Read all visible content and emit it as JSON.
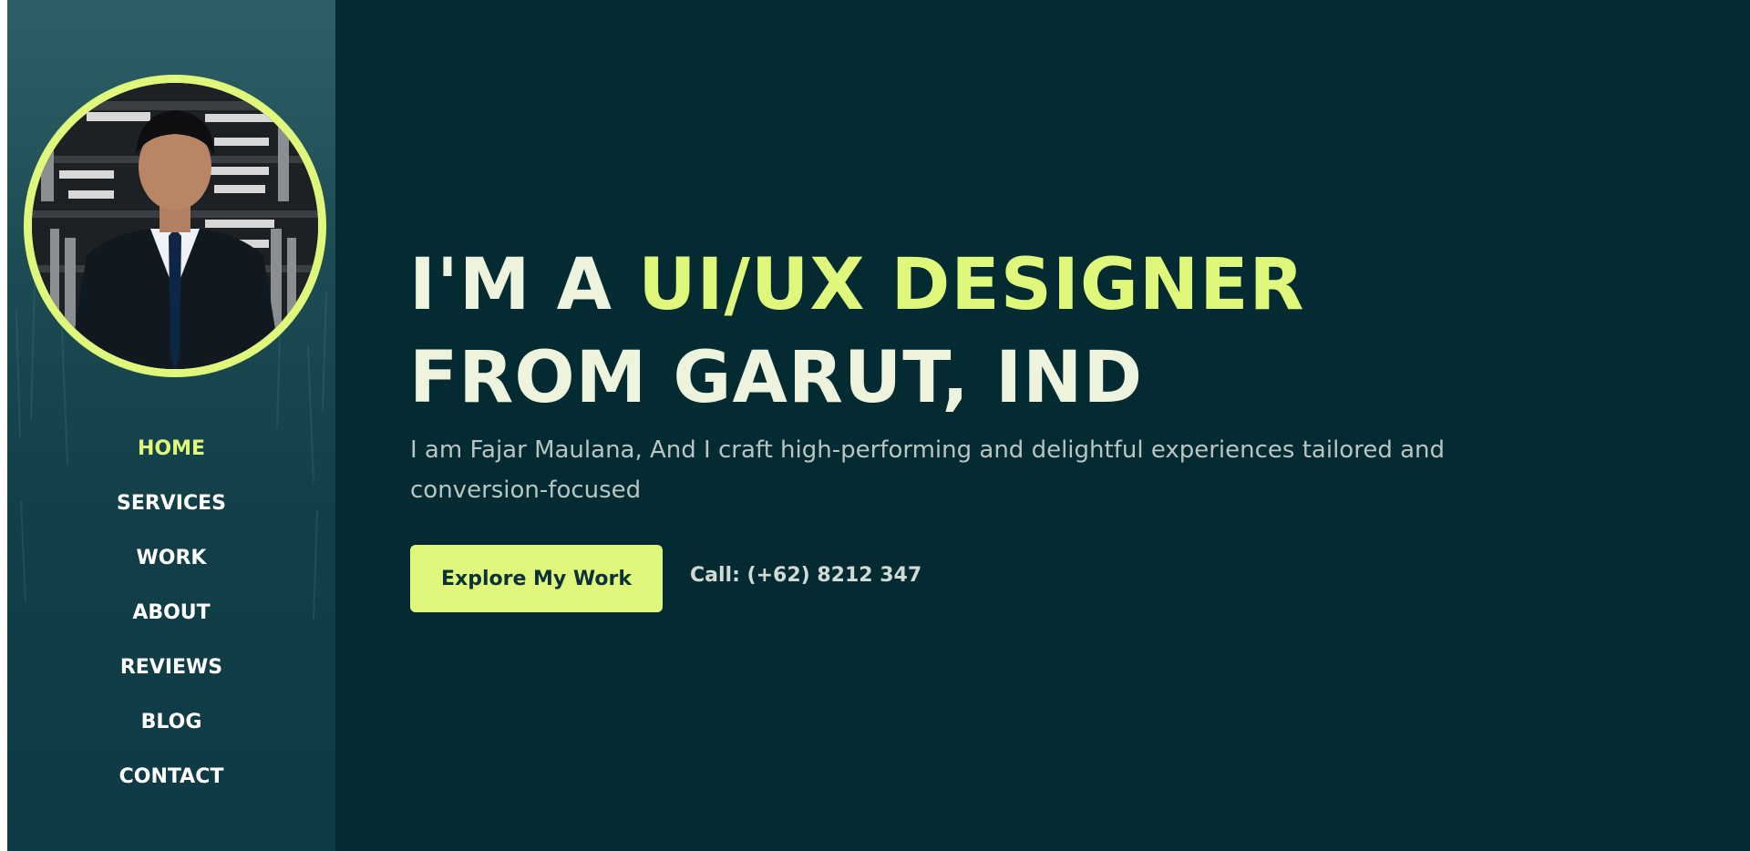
{
  "sidebar": {
    "avatar_alt": "Portrait photo",
    "nav": [
      {
        "label": "HOME",
        "active": true
      },
      {
        "label": "SERVICES",
        "active": false
      },
      {
        "label": "WORK",
        "active": false
      },
      {
        "label": "ABOUT",
        "active": false
      },
      {
        "label": "REVIEWS",
        "active": false
      },
      {
        "label": "BLOG",
        "active": false
      },
      {
        "label": "CONTACT",
        "active": false
      }
    ]
  },
  "hero": {
    "title_prefix": "I'M A ",
    "title_accent": "UI/UX DESIGNER",
    "title_line2": "FROM GARUT, IND",
    "subtitle": "I am Fajar Maulana, And I craft high-performing and delightful experiences tailored and conversion-focused",
    "cta_label": "Explore My Work",
    "call_text": "Call: (+62) 8212 347"
  },
  "colors": {
    "accent": "#dff77a",
    "background": "#042a32",
    "sidebar_top": "#2e5f66",
    "sidebar_bottom": "#0d3a44",
    "title_text": "#eef3de",
    "body_text": "#b7c5c3"
  }
}
